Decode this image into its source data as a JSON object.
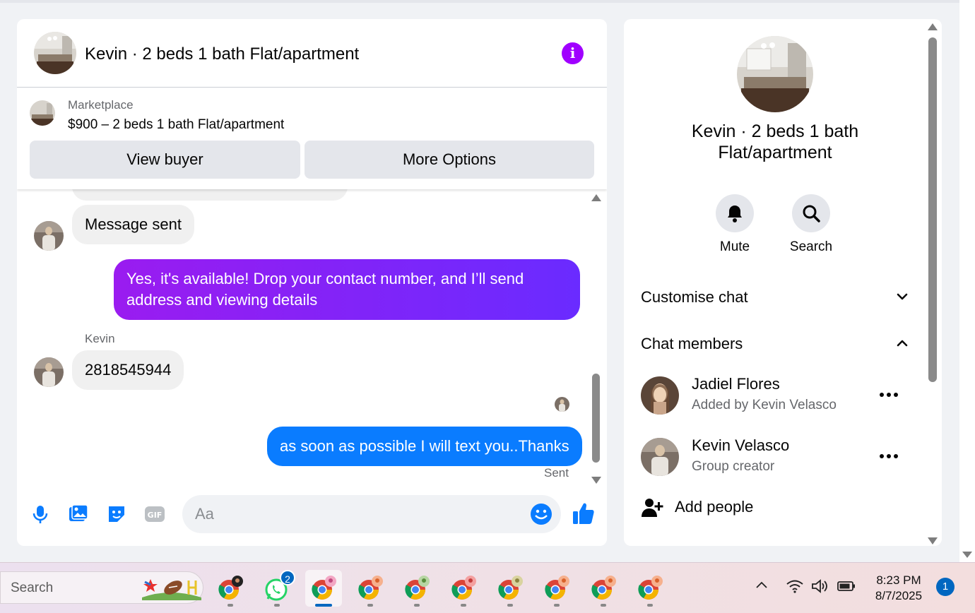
{
  "chat": {
    "title": "Kevin · 2 beds 1 bath Flat/apartment",
    "marketplace_label": "Marketplace",
    "listing": "$900 – 2 beds 1 bath Flat/apartment",
    "view_buyer": "View buyer",
    "more_options": "More Options",
    "messages": [
      {
        "from": "them",
        "text": "Message sent"
      },
      {
        "from": "me",
        "text": "Yes, it's available! Drop your contact number, and I’ll send address and viewing details"
      },
      {
        "from": "them",
        "sender": "Kevin",
        "text": "2818545944"
      },
      {
        "from": "me",
        "text": "as soon as possible I will text you..Thanks"
      }
    ],
    "sent_label": "Sent",
    "composer_placeholder": "Aa"
  },
  "side": {
    "title": "Kevin · 2 beds 1 bath Flat/apartment",
    "mute": "Mute",
    "search": "Search",
    "customise_chat": "Customise chat",
    "chat_members": "Chat members",
    "members": [
      {
        "name": "Jadiel Flores",
        "sub": "Added by Kevin Velasco"
      },
      {
        "name": "Kevin Velasco",
        "sub": "Group creator"
      }
    ],
    "add_people": "Add people"
  },
  "taskbar": {
    "search": "Search",
    "whatsapp_badge": "2",
    "time": "8:23 PM",
    "date": "8/7/2025",
    "notifications": "1"
  },
  "colors": {
    "accent_purple": "#a000ff",
    "bubble_blue": "#0a7cff",
    "messenger_blue": "#0a7cff"
  }
}
